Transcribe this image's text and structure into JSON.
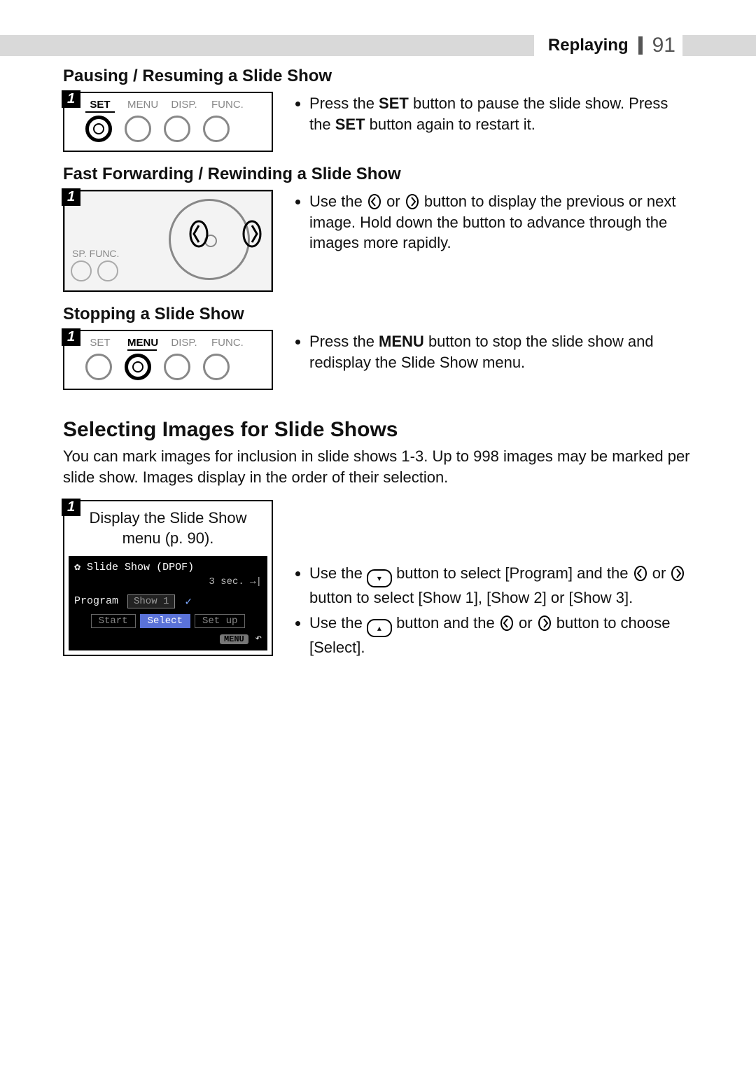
{
  "header": {
    "section": "Replaying",
    "page_number": "91"
  },
  "pausing": {
    "heading": "Pausing / Resuming a Slide Show",
    "step_number": "1",
    "cam_labels": {
      "set": "SET",
      "menu": "MENU",
      "disp": "DISP.",
      "func": "FUNC."
    },
    "text_prefix": "Press the ",
    "bold1": "SET",
    "text_mid": " button to pause the slide show. Press the ",
    "bold2": "SET",
    "text_suffix": " button again to restart it."
  },
  "fastforward": {
    "heading": "Fast Forwarding / Rewinding a Slide Show",
    "step_number": "1",
    "sp_func_label": "SP.  FUNC.",
    "text_prefix": "Use the ",
    "text_mid": " or ",
    "text_suffix": " button to display the previous or next image. Hold down the button to advance through the images more rapidly."
  },
  "stopping": {
    "heading": "Stopping a Slide Show",
    "step_number": "1",
    "cam_labels": {
      "set": "SET",
      "menu": "MENU",
      "disp": "DISP.",
      "func": "FUNC."
    },
    "text_prefix": "Press the ",
    "bold1": "MENU",
    "text_suffix": " button to stop the slide show and redisplay the Slide Show menu."
  },
  "selecting": {
    "heading": "Selecting Images for Slide Shows",
    "intro": "You can mark images for inclusion in slide shows 1-3. Up to 998 images may be marked per slide show. Images display in the order of their selection.",
    "step_number": "1",
    "caption_line1": "Display the Slide Show",
    "caption_line2": "menu (p. 90).",
    "lcd": {
      "title": "Slide Show (DPOF)",
      "duration": "3 sec.",
      "program_label": "Program",
      "program_value": "Show 1",
      "btn_start": "Start",
      "btn_select": "Select",
      "btn_setup": "Set up",
      "menu_badge": "MENU"
    },
    "bullets": {
      "b1_a": "Use the ",
      "b1_b": " button to select [Program] and the ",
      "b1_c": " or ",
      "b1_d": " button to select [Show 1], [Show 2] or [Show 3].",
      "b2_a": "Use the ",
      "b2_b": " button and the ",
      "b2_c": " or ",
      "b2_d": " button to choose [Select]."
    }
  }
}
